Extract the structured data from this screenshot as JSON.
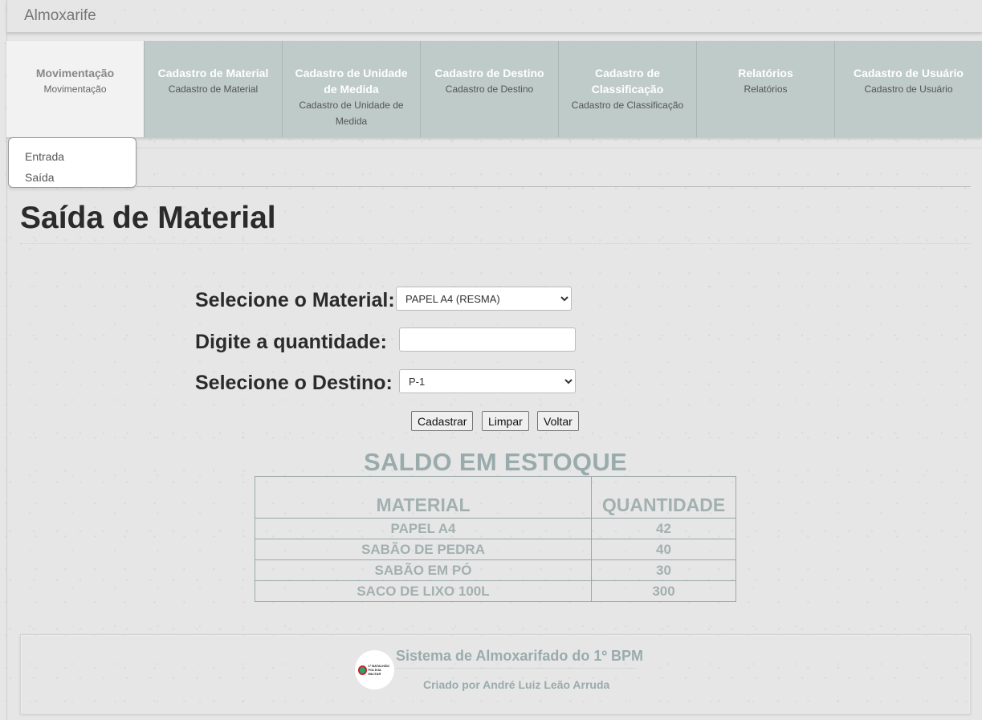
{
  "app": {
    "brand": "Almoxarife"
  },
  "nav": {
    "items": [
      {
        "title": "Movimentação",
        "subtitle": "Movimentação"
      },
      {
        "title": "Cadastro de Material",
        "subtitle": "Cadastro de Material"
      },
      {
        "title": "Cadastro de Unidade de Medida",
        "subtitle": "Cadastro de Unidade de Medida"
      },
      {
        "title": "Cadastro de Destino",
        "subtitle": "Cadastro de Destino"
      },
      {
        "title": "Cadastro de Classificação",
        "subtitle": "Cadastro de Classificação"
      },
      {
        "title": "Relatórios",
        "subtitle": "Relatórios"
      },
      {
        "title": "Cadastro de Usuário",
        "subtitle": "Cadastro de Usuário"
      }
    ],
    "active_index": 0
  },
  "dropdown": {
    "items": [
      "Entrada",
      "Saída"
    ]
  },
  "page": {
    "title": "Saída de Material"
  },
  "form": {
    "material_label": "Selecione o Material:",
    "material_value": "PAPEL A4 (RESMA)",
    "quantity_label": "Digite a quantidade:",
    "quantity_value": "",
    "destino_label": "Selecione o Destino:",
    "destino_value": "P-1",
    "buttons": {
      "submit": "Cadastrar",
      "clear": "Limpar",
      "back": "Voltar"
    }
  },
  "stock": {
    "title": "SALDO EM ESTOQUE",
    "headers": [
      "MATERIAL",
      "QUANTIDADE"
    ],
    "rows": [
      [
        "PAPEL A4",
        "42"
      ],
      [
        "SABÃO DE PEDRA",
        "40"
      ],
      [
        "SABÃO EM PÓ",
        "30"
      ],
      [
        "SACO DE LIXO 100L",
        "300"
      ]
    ]
  },
  "footer": {
    "title": "Sistema de Almoxarifado do 1º BPM",
    "credit": "Criado por André Luiz Leão Arruda",
    "logo_text_line1": "1º BATALHÃO",
    "logo_text_line2": "POLÍCIA MILITAR"
  },
  "colors": {
    "nav_bg": "#bfcbc9",
    "nav_active_bg": "#f2f2f2",
    "accent_text": "#99abab"
  }
}
